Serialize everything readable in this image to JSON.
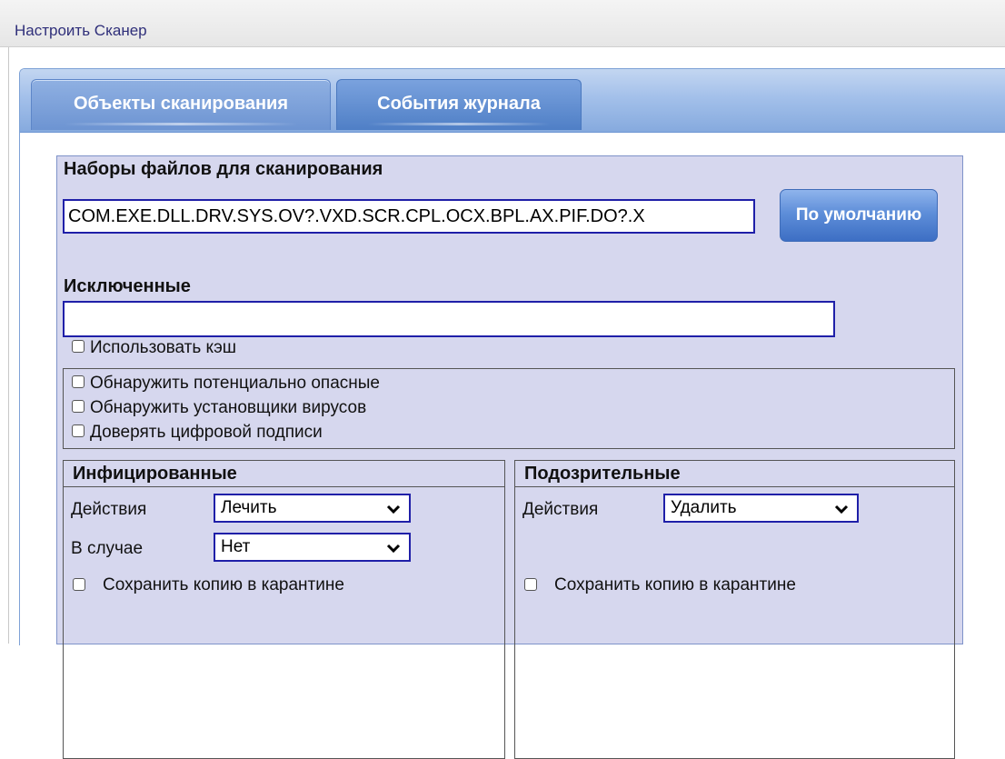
{
  "window": {
    "title": "Настроить Сканер"
  },
  "tabs": [
    {
      "label": "Объекты сканирования",
      "active": true
    },
    {
      "label": "События журнала",
      "active": false
    }
  ],
  "scan_sets": {
    "label": "Наборы файлов для сканирования",
    "value": "COM.EXE.DLL.DRV.SYS.OV?.VXD.SCR.CPL.OCX.BPL.AX.PIF.DO?.X",
    "default_button": "По умолчанию"
  },
  "excluded": {
    "label": "Исключенные",
    "value": ""
  },
  "use_cache": {
    "label": "Использовать кэш",
    "checked": false
  },
  "detect_options": [
    {
      "label": "Обнаружить потенциально опасные",
      "checked": false
    },
    {
      "label": "Обнаружить установщики вирусов",
      "checked": false
    },
    {
      "label": "Доверять цифровой подписи",
      "checked": false
    }
  ],
  "infected": {
    "title": "Инфицированные",
    "action_label": "Действия",
    "action_value": "Лечить",
    "fallback_label": "В случае",
    "fallback_value": "Нет",
    "quarantine_label": "Сохранить копию в карантине",
    "quarantine_checked": false
  },
  "suspicious": {
    "title": "Подозрительные",
    "action_label": "Действия",
    "action_value": "Удалить",
    "quarantine_label": "Сохранить копию в карантине",
    "quarantine_checked": false
  },
  "colors": {
    "panel_bg": "#d6d7ee",
    "tab_bar": "#86aade",
    "input_border": "#1f1fa8",
    "button": "#5e8ed9"
  }
}
